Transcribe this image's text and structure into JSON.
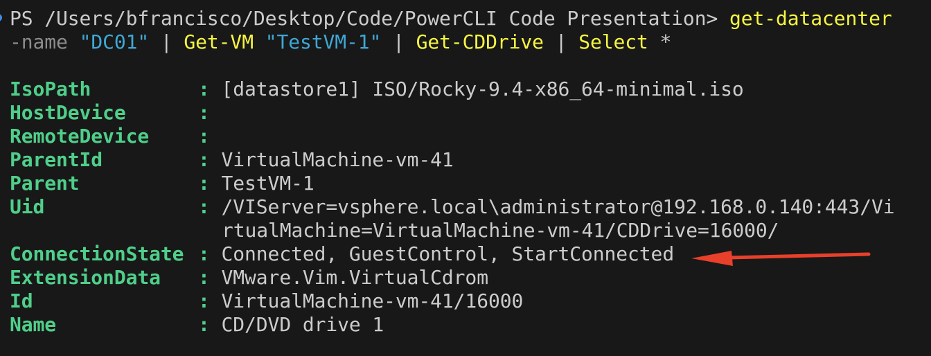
{
  "terminal": {
    "prompt": "PS /Users/bfrancisco/Desktop/Code/PowerCLI Code Presentation>",
    "command": {
      "cmd1": "get-datacenter",
      "param1": "-name",
      "arg1": "\"DC01\"",
      "pipe1": "|",
      "cmd2": "Get-VM",
      "arg2": "\"TestVM-1\"",
      "pipe2": "|",
      "cmd3": "Get-CDDrive",
      "pipe3": "|",
      "cmd4": "Select",
      "arg4": "*"
    },
    "separator": ":",
    "properties": [
      {
        "key": "IsoPath",
        "value": "[datastore1] ISO/Rocky-9.4-x86_64-minimal.iso"
      },
      {
        "key": "HostDevice",
        "value": ""
      },
      {
        "key": "RemoteDevice",
        "value": ""
      },
      {
        "key": "ParentId",
        "value": "VirtualMachine-vm-41"
      },
      {
        "key": "Parent",
        "value": "TestVM-1"
      },
      {
        "key": "Uid",
        "value": "/VIServer=vsphere.local\\administrator@192.168.0.140:443/Vi",
        "continuation": "rtualMachine=VirtualMachine-vm-41/CDDrive=16000/"
      },
      {
        "key": "ConnectionState",
        "value": "Connected, GuestControl, StartConnected"
      },
      {
        "key": "ExtensionData",
        "value": "VMware.Vim.VirtualCdrom"
      },
      {
        "key": "Id",
        "value": "VirtualMachine-vm-41/16000"
      },
      {
        "key": "Name",
        "value": "CD/DVD drive 1"
      }
    ]
  },
  "annotation": {
    "arrow_color": "#e8402a",
    "points_to": "ConnectionState"
  }
}
